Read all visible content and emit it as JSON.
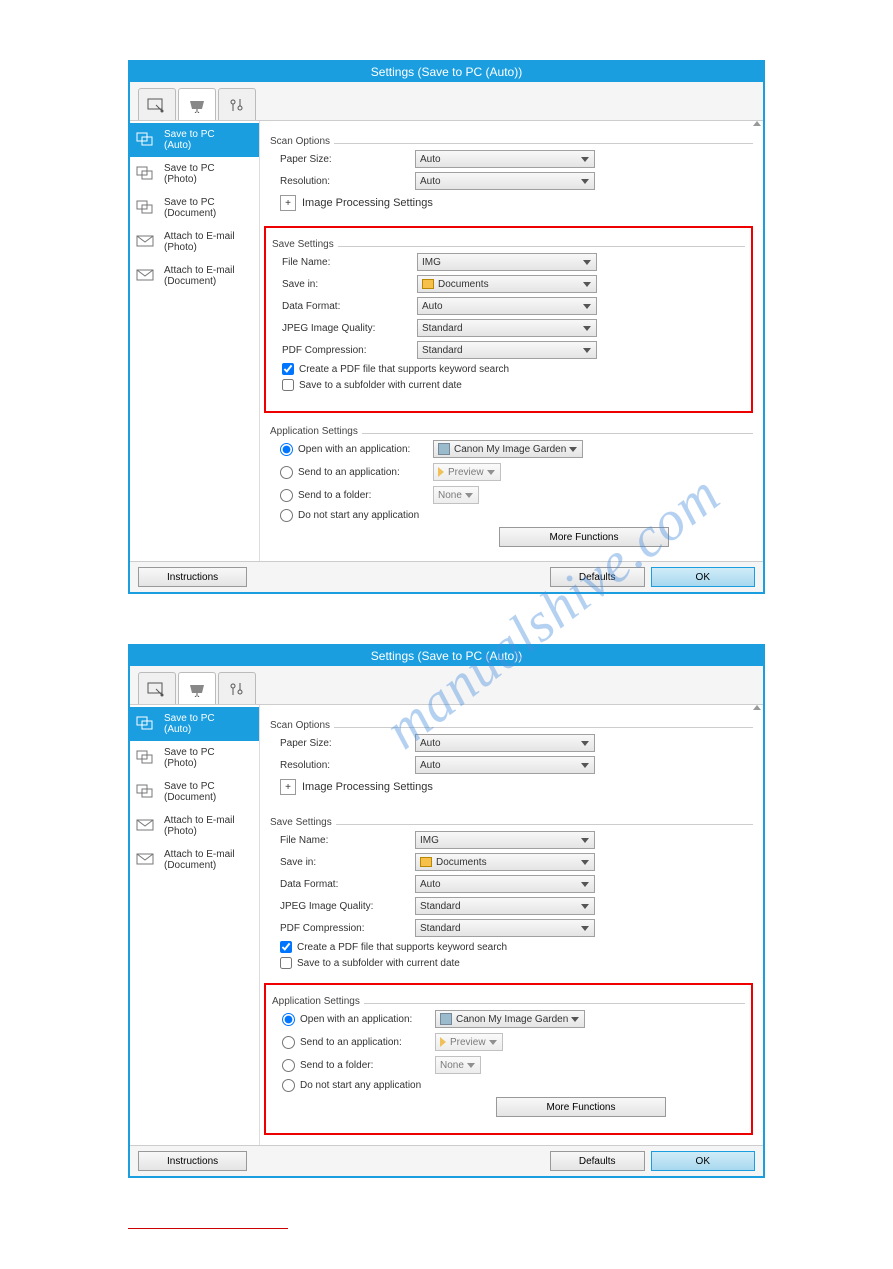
{
  "window": {
    "title": "Settings (Save to PC (Auto))"
  },
  "sidebar": {
    "items": [
      {
        "label": "Save to PC\n(Auto)"
      },
      {
        "label": "Save to PC\n(Photo)"
      },
      {
        "label": "Save to PC\n(Document)"
      },
      {
        "label": "Attach to E-mail\n(Photo)"
      },
      {
        "label": "Attach to E-mail\n(Document)"
      }
    ]
  },
  "scan": {
    "section": "Scan Options",
    "paper_size_label": "Paper Size:",
    "paper_size_value": "Auto",
    "resolution_label": "Resolution:",
    "resolution_value": "Auto",
    "expand_plus": "+",
    "image_proc_label": "Image Processing Settings"
  },
  "save": {
    "section": "Save Settings",
    "file_name_label": "File Name:",
    "file_name_value": "IMG",
    "save_in_label": "Save in:",
    "save_in_value": "Documents",
    "data_format_label": "Data Format:",
    "data_format_value": "Auto",
    "jpeg_label": "JPEG Image Quality:",
    "jpeg_value": "Standard",
    "pdf_comp_label": "PDF Compression:",
    "pdf_comp_value": "Standard",
    "chk_keyword": "Create a PDF file that supports keyword search",
    "chk_subfolder": "Save to a subfolder with current date"
  },
  "app": {
    "section": "Application Settings",
    "open_app_label": "Open with an application:",
    "open_app_value": "Canon My Image Garden",
    "send_app_label": "Send to an application:",
    "send_app_value": "Preview",
    "send_folder_label": "Send to a folder:",
    "send_folder_value": "None",
    "do_not_start": "Do not start any application",
    "more_functions": "More Functions"
  },
  "buttons": {
    "instructions": "Instructions",
    "defaults": "Defaults",
    "ok": "OK"
  },
  "watermark": "manualshive.com"
}
